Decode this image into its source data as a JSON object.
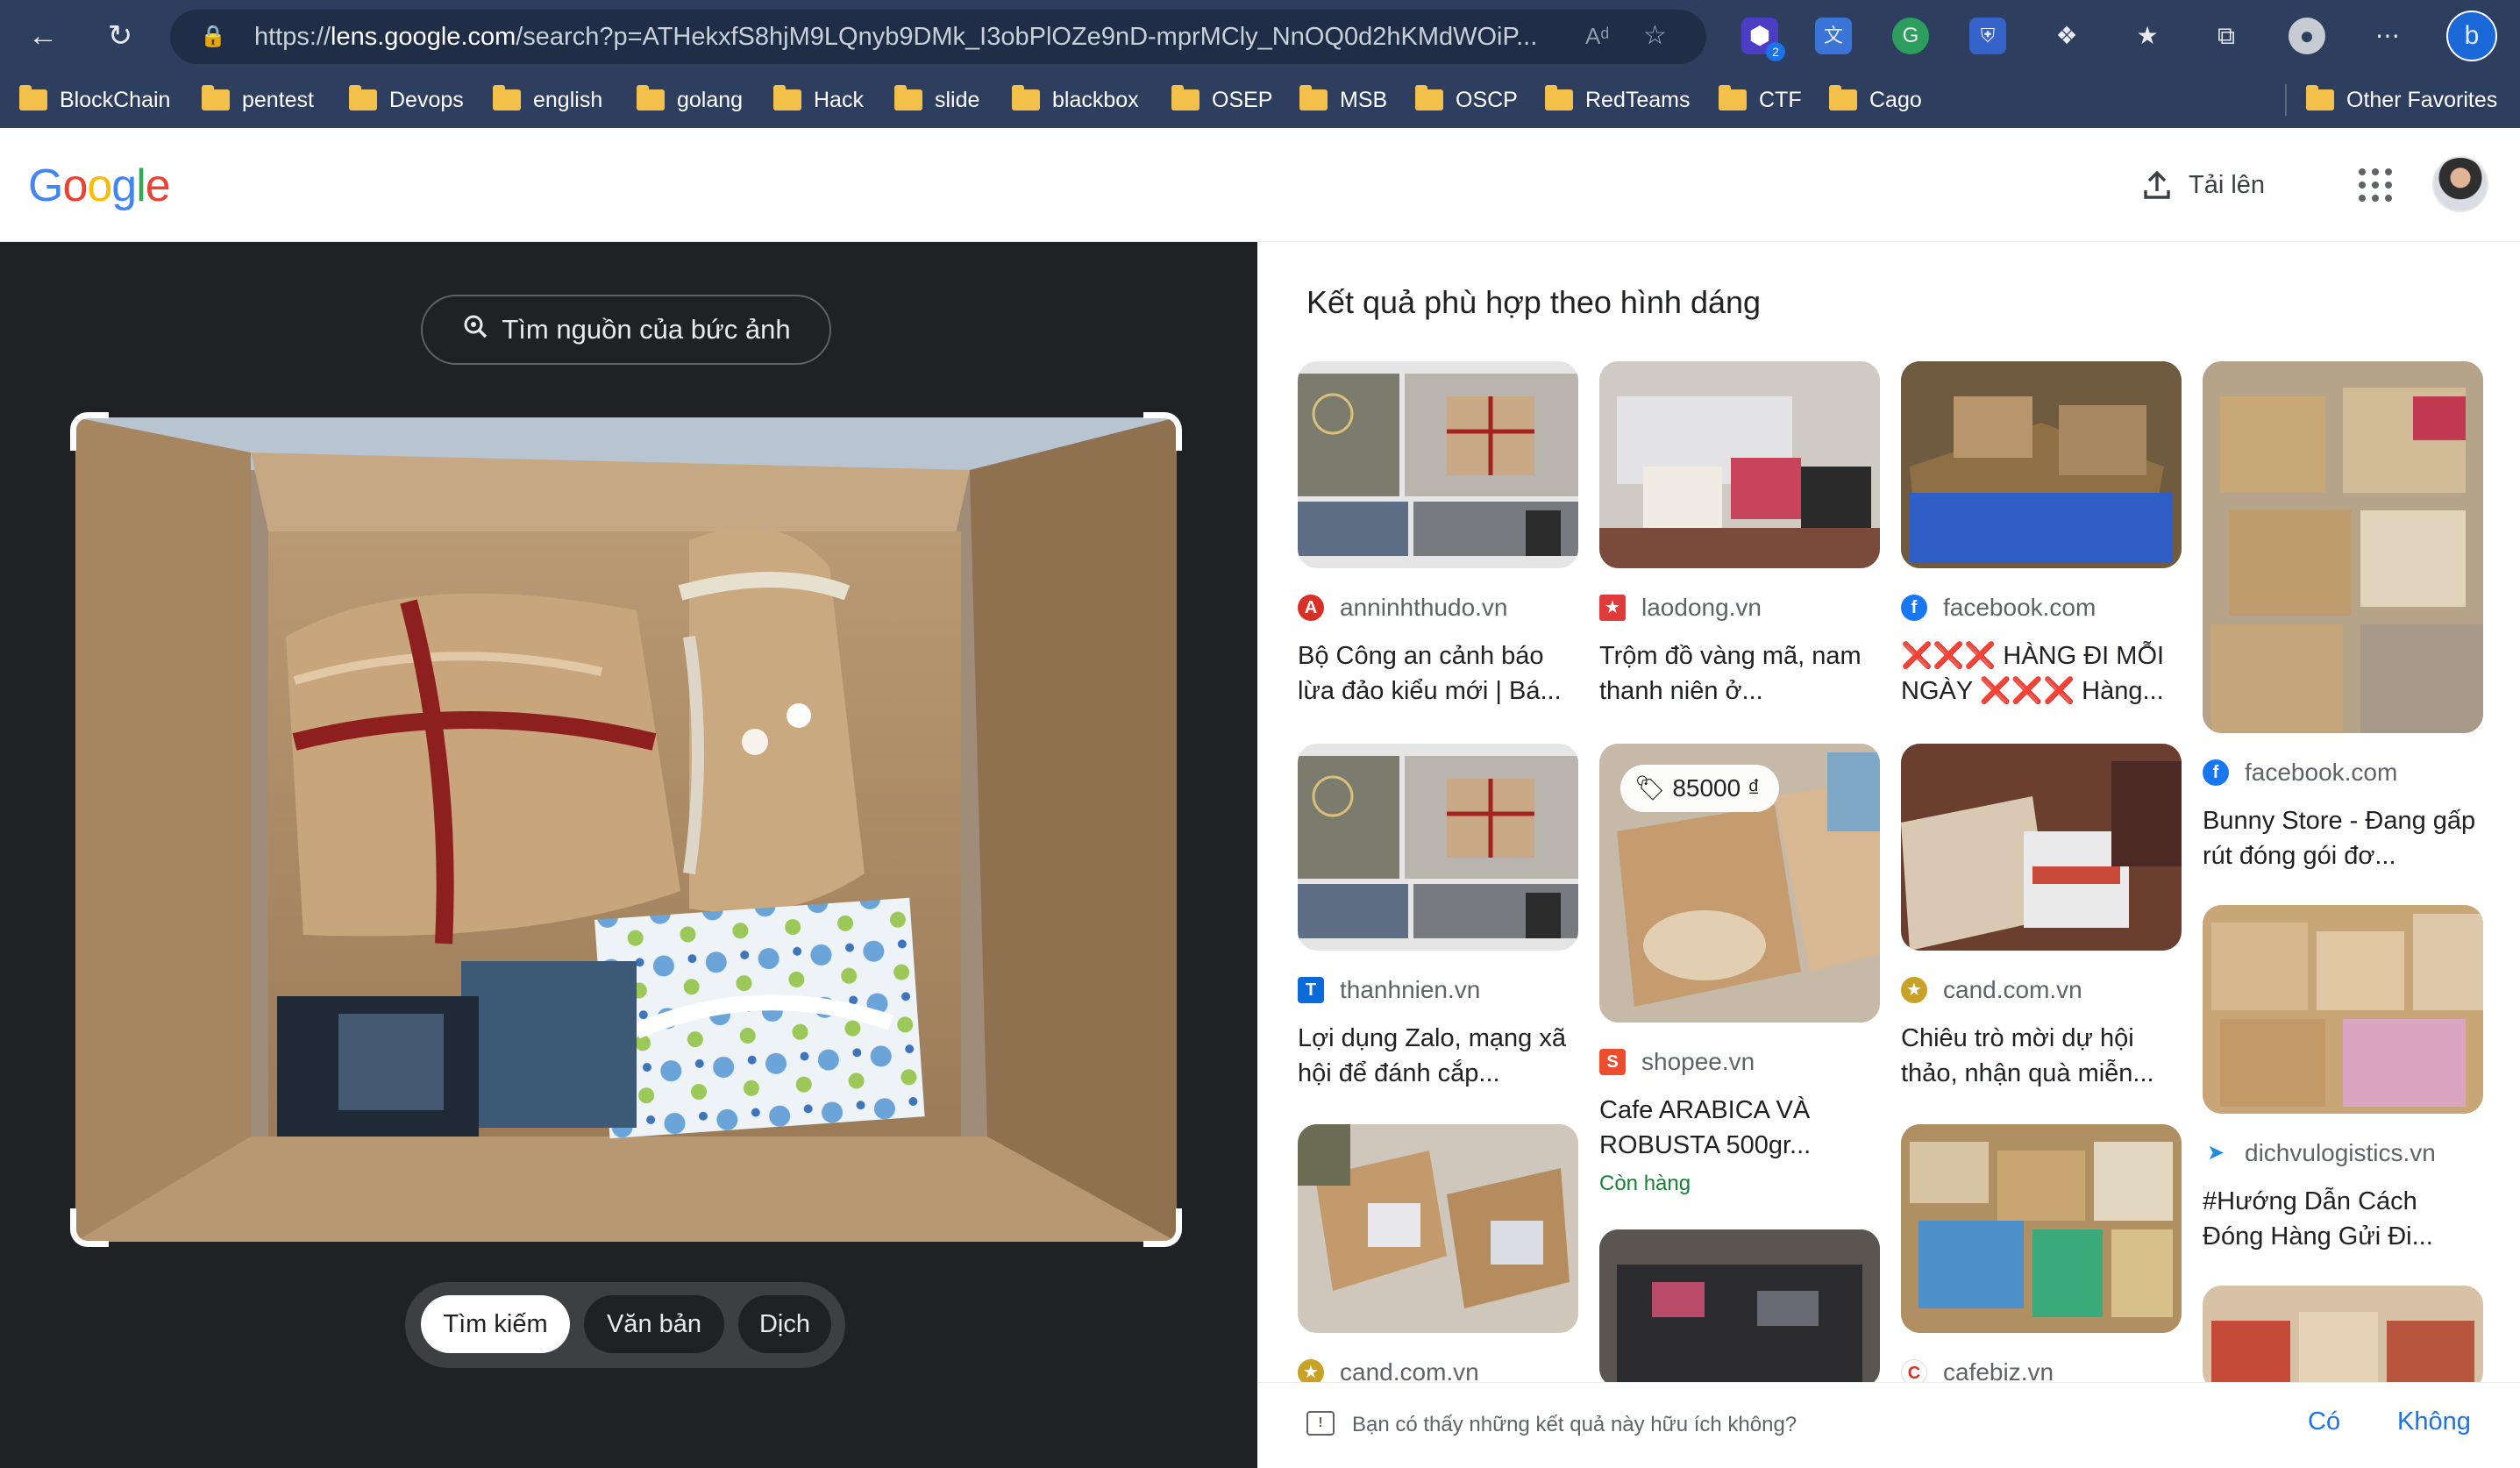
{
  "browser": {
    "url_prefix": "https://",
    "url_host": "lens.google.com",
    "url_rest": "/search?p=ATHekxfS8hjM9LQnyb9DMk_I3obPlOZe9nD-mprMCly_NnOQ0d2hKMdWOiP...",
    "ext_badge": "2",
    "bookmarks": [
      "BlockChain",
      "pentest",
      "Devops",
      "english",
      "golang",
      "Hack",
      "slide",
      "blackbox",
      "OSEP",
      "MSB",
      "OSCP",
      "RedTeams",
      "CTF",
      "Cago"
    ],
    "other_favorites": "Other Favorites"
  },
  "header": {
    "logo": [
      "G",
      "o",
      "o",
      "g",
      "l",
      "e"
    ],
    "logo_colors": [
      "#4285f4",
      "#ea4335",
      "#fbbc05",
      "#4285f4",
      "#34a853",
      "#ea4335"
    ],
    "upload_label": "Tải lên"
  },
  "lens": {
    "find_source_label": "Tìm nguồn của bức ảnh",
    "tabs": [
      "Tìm kiếm",
      "Văn bản",
      "Dịch"
    ],
    "active_tab": "Tìm kiếm"
  },
  "results": {
    "heading": "Kết quả phù hợp theo hình dáng",
    "items": [
      {
        "source": "anninhthudo.vn",
        "title": "Bộ Công an cảnh báo lừa đảo kiểu mới | Bá..."
      },
      {
        "source": "laodong.vn",
        "title": "Trộm đồ vàng mã, nam thanh niên ở..."
      },
      {
        "source": "facebook.com",
        "title_mark": "❌❌❌",
        "title_a": "HÀNG ĐI MỖI NGÀY",
        "title_mark2": "❌❌❌",
        "title_b": "Hàng..."
      },
      {
        "source": "facebook.com",
        "title": "Bunny Store - Đang gấp rút đóng gói đơ..."
      },
      {
        "source": "thanhnien.vn",
        "title": "Lợi dụng Zalo, mạng xã hội để đánh cắp..."
      },
      {
        "source": "shopee.vn",
        "title": "Cafe ARABICA VÀ ROBUSTA 500gr...",
        "price": "85000 ₫",
        "stock": "Còn hàng"
      },
      {
        "source": "cand.com.vn",
        "title": "Chiêu trò mời dự hội thảo, nhận quà miễn..."
      },
      {
        "source": "dichvulogistics.vn",
        "title": "#Hướng Dẫn Cách Đóng Hàng Gửi Đi..."
      },
      {
        "source": "cand.com.vn"
      },
      {
        "source": "cafebiz.vn"
      }
    ],
    "feedback_question": "Bạn có thấy những kết quả này hữu ích không?",
    "feedback_yes": "Có",
    "feedback_no": "Không"
  }
}
